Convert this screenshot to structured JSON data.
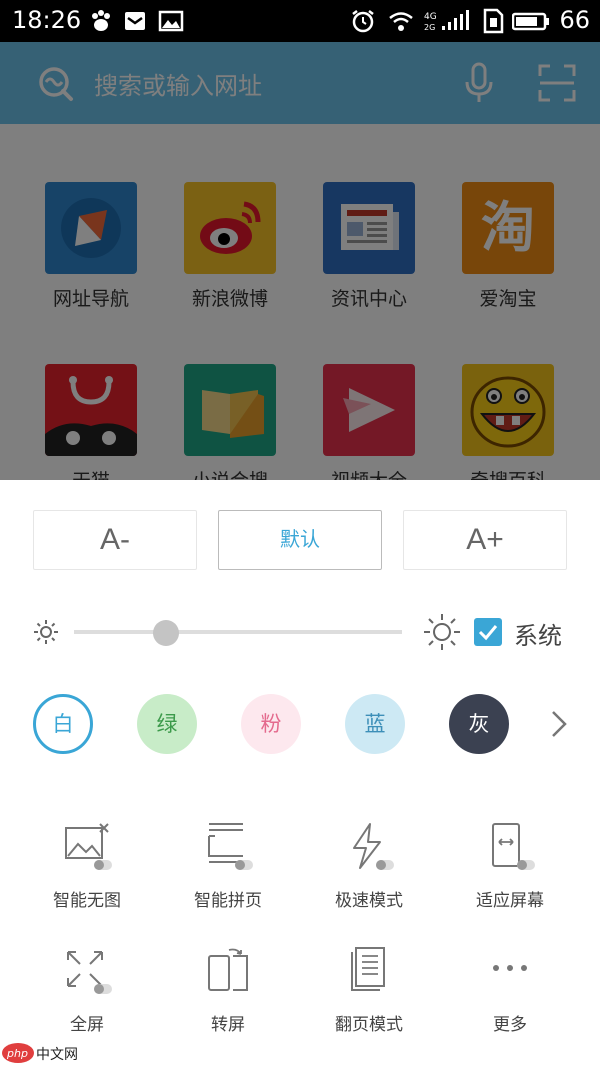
{
  "status_bar": {
    "time": "18:26",
    "battery": "66"
  },
  "search": {
    "placeholder": "搜索或输入网址"
  },
  "apps": [
    {
      "label": "网址导航",
      "color": "#2f87cf"
    },
    {
      "label": "新浪微博",
      "color": "#f6c326"
    },
    {
      "label": "资讯中心",
      "color": "#2f6fc2"
    },
    {
      "label": "爱淘宝",
      "color": "#f08c15",
      "glyph": "淘"
    },
    {
      "label": "天猫",
      "color": "#e8232c"
    },
    {
      "label": "小说合搜",
      "color": "#1ea686"
    },
    {
      "label": "视频大全",
      "color": "#e8304d"
    },
    {
      "label": "奇搜百科",
      "color": "#f5c41b"
    }
  ],
  "font": {
    "decrease": "A-",
    "default": "默认",
    "increase": "A+"
  },
  "brightness": {
    "level": 0.28,
    "system_label": "系统",
    "system_checked": true
  },
  "themes": [
    {
      "label": "白",
      "bg": "#ffffff",
      "fg": "#3aa6d6",
      "selected": true
    },
    {
      "label": "绿",
      "bg": "#c8ecc8",
      "fg": "#3c9a4b"
    },
    {
      "label": "粉",
      "bg": "#fde8ee",
      "fg": "#e46a8d"
    },
    {
      "label": "蓝",
      "bg": "#cde9f4",
      "fg": "#3d8fb8"
    },
    {
      "label": "灰",
      "bg": "#3b4151",
      "fg": "#ffffff"
    }
  ],
  "tools": [
    {
      "label": "智能无图",
      "icon": "no-image-icon"
    },
    {
      "label": "智能拼页",
      "icon": "page-merge-icon"
    },
    {
      "label": "极速模式",
      "icon": "lightning-icon"
    },
    {
      "label": "适应屏幕",
      "icon": "fit-screen-icon"
    },
    {
      "label": "全屏",
      "icon": "fullscreen-icon"
    },
    {
      "label": "转屏",
      "icon": "rotate-screen-icon"
    },
    {
      "label": "翻页模式",
      "icon": "page-turn-icon"
    },
    {
      "label": "更多",
      "icon": "more-icon"
    }
  ],
  "watermark": {
    "logo": "php",
    "text": "中文网"
  }
}
